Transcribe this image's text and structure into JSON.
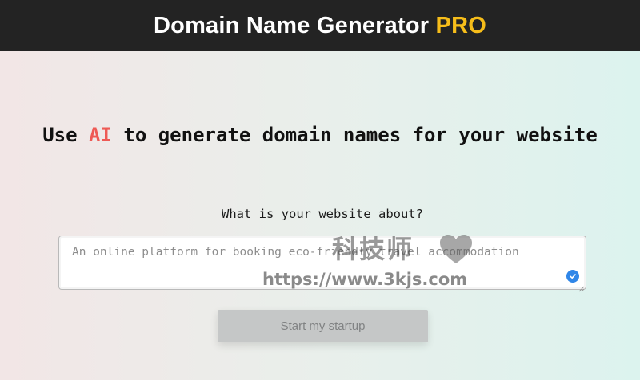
{
  "header": {
    "title_main": "Domain Name Generator",
    "title_badge": "PRO",
    "badge_color": "#f6bd1a",
    "background": "#232323"
  },
  "hero": {
    "headline_before": "Use",
    "headline_highlight": "AI",
    "headline_after": "to generate domain names for your website",
    "highlight_color": "#ee5a55"
  },
  "form": {
    "prompt_label": "What is your website about?",
    "description_placeholder": "An online platform for booking eco-friendly travel accommodation",
    "submit_label": "Start my startup",
    "submit_disabled": true,
    "field_icon": "check-circle-icon"
  },
  "watermark": {
    "text": "科技师",
    "url": "https://www.3kjs.com",
    "icon": "heart-icon"
  }
}
